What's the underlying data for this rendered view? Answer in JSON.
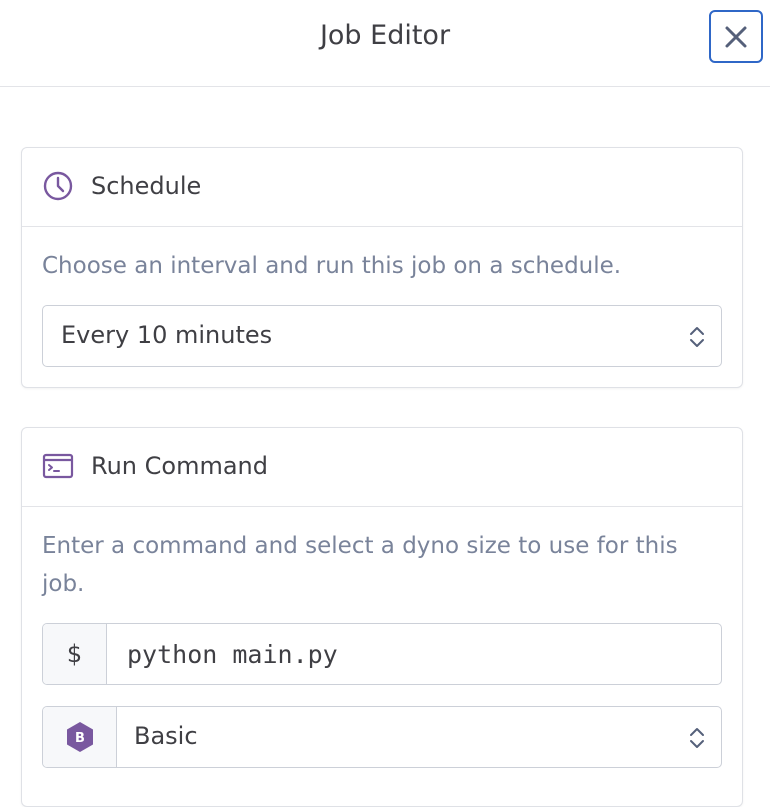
{
  "header": {
    "title": "Job Editor",
    "close_icon": "close-icon"
  },
  "schedule": {
    "title": "Schedule",
    "icon": "clock-icon",
    "description": "Choose an interval and run this job on a schedule.",
    "interval_value": "Every 10 minutes"
  },
  "run_command": {
    "title": "Run Command",
    "icon": "terminal-icon",
    "description": "Enter a command and select a dyno size to use for this job.",
    "prompt_symbol": "$",
    "command_value": "python main.py",
    "dyno_badge": "B",
    "dyno_value": "Basic"
  },
  "colors": {
    "accent_purple": "#79589f",
    "focus_blue": "#2f67c7",
    "text_dark": "#3f3f44",
    "text_muted": "#79839a",
    "border": "#ccd0d8"
  }
}
